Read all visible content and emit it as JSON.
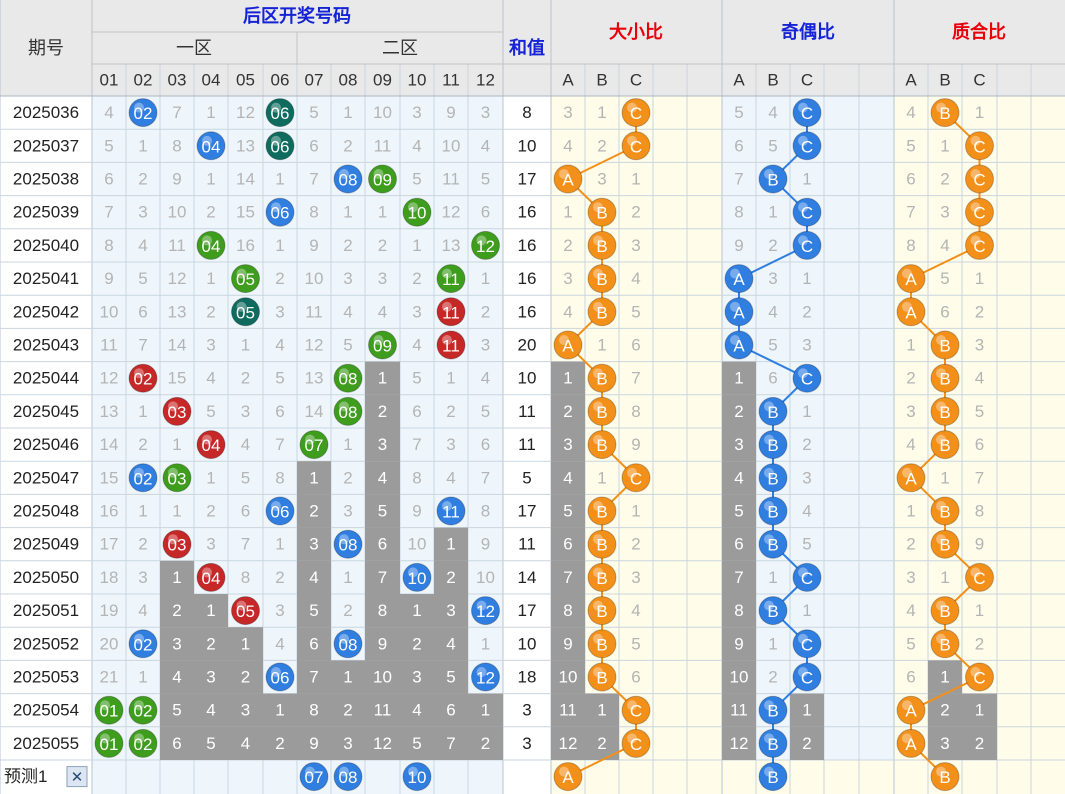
{
  "header": {
    "issue_label": "期号",
    "back_zone_title": "后区开奖号码",
    "zone1_label": "一区",
    "zone2_label": "二区",
    "sum_label": "和值",
    "size_label": "大小比",
    "parity_label": "奇偶比",
    "prime_label": "质合比",
    "predict_label": "预测1",
    "close_glyph": "✕"
  },
  "colors": {
    "header_red": "#e8000b",
    "header_blue": "#1523d6",
    "ball_blue": "#2f7ee0",
    "ball_dark_teal": "#0e6b5e",
    "ball_green": "#3f9d1e",
    "ball_red": "#c62828",
    "ball_orange": "#f39019",
    "gray_cell": "#9b9b9b"
  },
  "chart_data": {
    "type": "table",
    "number_columns": [
      "01",
      "02",
      "03",
      "04",
      "05",
      "06",
      "07",
      "08",
      "09",
      "10",
      "11",
      "12"
    ],
    "ratio_columns": [
      "A",
      "B",
      "C"
    ],
    "rows": [
      {
        "issue": "2025036",
        "nums": [
          "4",
          "02",
          "7",
          "1",
          "12",
          "06",
          "5",
          "1",
          "10",
          "3",
          "9",
          "3"
        ],
        "balls": [
          [
            2,
            "blue"
          ],
          [
            6,
            "teal"
          ]
        ],
        "sum": "8",
        "size": [
          "3",
          "1",
          "C"
        ],
        "parity": [
          "5",
          "4",
          "C"
        ],
        "prime": [
          "4",
          "B",
          "1"
        ]
      },
      {
        "issue": "2025037",
        "nums": [
          "5",
          "1",
          "8",
          "04",
          "13",
          "06",
          "6",
          "2",
          "11",
          "4",
          "10",
          "4"
        ],
        "balls": [
          [
            4,
            "blue"
          ],
          [
            6,
            "teal"
          ]
        ],
        "sum": "10",
        "size": [
          "4",
          "2",
          "C"
        ],
        "parity": [
          "6",
          "5",
          "C"
        ],
        "prime": [
          "5",
          "1",
          "C"
        ]
      },
      {
        "issue": "2025038",
        "nums": [
          "6",
          "2",
          "9",
          "1",
          "14",
          "1",
          "7",
          "08",
          "09",
          "5",
          "11",
          "5"
        ],
        "balls": [
          [
            8,
            "blue"
          ],
          [
            9,
            "green"
          ]
        ],
        "sum": "17",
        "size": [
          "A",
          "3",
          "1"
        ],
        "parity": [
          "7",
          "B",
          "1"
        ],
        "prime": [
          "6",
          "2",
          "C"
        ]
      },
      {
        "issue": "2025039",
        "nums": [
          "7",
          "3",
          "10",
          "2",
          "15",
          "06",
          "8",
          "1",
          "1",
          "10",
          "12",
          "6"
        ],
        "balls": [
          [
            6,
            "blue"
          ],
          [
            10,
            "green"
          ]
        ],
        "sum": "16",
        "size": [
          "1",
          "B",
          "2"
        ],
        "parity": [
          "8",
          "1",
          "C"
        ],
        "prime": [
          "7",
          "3",
          "C"
        ]
      },
      {
        "issue": "2025040",
        "nums": [
          "8",
          "4",
          "11",
          "04",
          "16",
          "1",
          "9",
          "2",
          "2",
          "1",
          "13",
          "12"
        ],
        "balls": [
          [
            4,
            "green"
          ],
          [
            12,
            "green"
          ]
        ],
        "sum": "16",
        "size": [
          "2",
          "B",
          "3"
        ],
        "parity": [
          "9",
          "2",
          "C"
        ],
        "prime": [
          "8",
          "4",
          "C"
        ]
      },
      {
        "issue": "2025041",
        "nums": [
          "9",
          "5",
          "12",
          "1",
          "05",
          "2",
          "10",
          "3",
          "3",
          "2",
          "11",
          "1"
        ],
        "balls": [
          [
            5,
            "green"
          ],
          [
            11,
            "green"
          ]
        ],
        "sum": "16",
        "size": [
          "3",
          "B",
          "4"
        ],
        "parity": [
          "A",
          "3",
          "1"
        ],
        "prime": [
          "A",
          "5",
          "1"
        ]
      },
      {
        "issue": "2025042",
        "nums": [
          "10",
          "6",
          "13",
          "2",
          "05",
          "3",
          "11",
          "4",
          "4",
          "3",
          "11",
          "2"
        ],
        "balls": [
          [
            5,
            "teal"
          ],
          [
            11,
            "red"
          ]
        ],
        "sum": "16",
        "size": [
          "4",
          "B",
          "5"
        ],
        "parity": [
          "A",
          "4",
          "2"
        ],
        "prime": [
          "A",
          "6",
          "2"
        ]
      },
      {
        "issue": "2025043",
        "nums": [
          "11",
          "7",
          "14",
          "3",
          "1",
          "4",
          "12",
          "5",
          "09",
          "4",
          "11",
          "3"
        ],
        "balls": [
          [
            9,
            "green"
          ],
          [
            11,
            "red"
          ]
        ],
        "sum": "20",
        "size": [
          "A",
          "1",
          "6"
        ],
        "parity": [
          "A",
          "5",
          "3"
        ],
        "prime": [
          "1",
          "B",
          "3"
        ]
      },
      {
        "issue": "2025044",
        "nums": [
          "12",
          "02",
          "15",
          "4",
          "2",
          "5",
          "13",
          "08",
          "1",
          "5",
          "1",
          "4"
        ],
        "balls": [
          [
            2,
            "red"
          ],
          [
            8,
            "green"
          ]
        ],
        "sum": "10",
        "size": [
          "1",
          "B",
          "7"
        ],
        "parity": [
          "1",
          "6",
          "C"
        ],
        "prime": [
          "2",
          "B",
          "4"
        ]
      },
      {
        "issue": "2025045",
        "nums": [
          "13",
          "1",
          "03",
          "5",
          "3",
          "6",
          "14",
          "08",
          "2",
          "6",
          "2",
          "5"
        ],
        "balls": [
          [
            3,
            "red"
          ],
          [
            8,
            "green"
          ]
        ],
        "sum": "11",
        "size": [
          "2",
          "B",
          "8"
        ],
        "parity": [
          "2",
          "B",
          "1"
        ],
        "prime": [
          "3",
          "B",
          "5"
        ]
      },
      {
        "issue": "2025046",
        "nums": [
          "14",
          "2",
          "1",
          "04",
          "4",
          "7",
          "07",
          "1",
          "3",
          "7",
          "3",
          "6"
        ],
        "balls": [
          [
            4,
            "red"
          ],
          [
            7,
            "green"
          ]
        ],
        "sum": "11",
        "size": [
          "3",
          "B",
          "9"
        ],
        "parity": [
          "3",
          "B",
          "2"
        ],
        "prime": [
          "4",
          "B",
          "6"
        ]
      },
      {
        "issue": "2025047",
        "nums": [
          "15",
          "02",
          "03",
          "1",
          "5",
          "8",
          "1",
          "2",
          "4",
          "8",
          "4",
          "7"
        ],
        "balls": [
          [
            2,
            "blue"
          ],
          [
            3,
            "green"
          ]
        ],
        "sum": "5",
        "size": [
          "4",
          "1",
          "C"
        ],
        "parity": [
          "4",
          "B",
          "3"
        ],
        "prime": [
          "A",
          "1",
          "7"
        ]
      },
      {
        "issue": "2025048",
        "nums": [
          "16",
          "1",
          "1",
          "2",
          "6",
          "06",
          "2",
          "3",
          "5",
          "9",
          "11",
          "8"
        ],
        "balls": [
          [
            6,
            "blue"
          ],
          [
            11,
            "blue"
          ]
        ],
        "sum": "17",
        "size": [
          "5",
          "B",
          "1"
        ],
        "parity": [
          "5",
          "B",
          "4"
        ],
        "prime": [
          "1",
          "B",
          "8"
        ]
      },
      {
        "issue": "2025049",
        "nums": [
          "17",
          "2",
          "03",
          "3",
          "7",
          "1",
          "3",
          "08",
          "6",
          "10",
          "1",
          "9"
        ],
        "balls": [
          [
            3,
            "red"
          ],
          [
            8,
            "blue"
          ]
        ],
        "sum": "11",
        "size": [
          "6",
          "B",
          "2"
        ],
        "parity": [
          "6",
          "B",
          "5"
        ],
        "prime": [
          "2",
          "B",
          "9"
        ]
      },
      {
        "issue": "2025050",
        "nums": [
          "18",
          "3",
          "1",
          "04",
          "8",
          "2",
          "4",
          "1",
          "7",
          "10",
          "2",
          "10"
        ],
        "balls": [
          [
            4,
            "red"
          ],
          [
            10,
            "blue"
          ]
        ],
        "sum": "14",
        "size": [
          "7",
          "B",
          "3"
        ],
        "parity": [
          "7",
          "1",
          "C"
        ],
        "prime": [
          "3",
          "1",
          "C"
        ]
      },
      {
        "issue": "2025051",
        "nums": [
          "19",
          "4",
          "2",
          "1",
          "05",
          "3",
          "5",
          "2",
          "8",
          "1",
          "3",
          "12"
        ],
        "balls": [
          [
            5,
            "red"
          ],
          [
            12,
            "blue"
          ]
        ],
        "sum": "17",
        "size": [
          "8",
          "B",
          "4"
        ],
        "parity": [
          "8",
          "B",
          "1"
        ],
        "prime": [
          "4",
          "B",
          "1"
        ]
      },
      {
        "issue": "2025052",
        "nums": [
          "20",
          "02",
          "3",
          "2",
          "1",
          "4",
          "6",
          "08",
          "9",
          "2",
          "4",
          "1"
        ],
        "balls": [
          [
            2,
            "blue"
          ],
          [
            8,
            "blue"
          ]
        ],
        "sum": "10",
        "size": [
          "9",
          "B",
          "5"
        ],
        "parity": [
          "9",
          "1",
          "C"
        ],
        "prime": [
          "5",
          "B",
          "2"
        ]
      },
      {
        "issue": "2025053",
        "nums": [
          "21",
          "1",
          "4",
          "3",
          "2",
          "06",
          "7",
          "1",
          "10",
          "3",
          "5",
          "12"
        ],
        "balls": [
          [
            6,
            "blue"
          ],
          [
            12,
            "blue"
          ]
        ],
        "sum": "18",
        "size": [
          "10",
          "B",
          "6"
        ],
        "parity": [
          "10",
          "2",
          "C"
        ],
        "prime": [
          "6",
          "1",
          "C"
        ]
      },
      {
        "issue": "2025054",
        "nums": [
          "01",
          "02",
          "5",
          "4",
          "3",
          "1",
          "8",
          "2",
          "11",
          "4",
          "6",
          "1"
        ],
        "balls": [
          [
            1,
            "green"
          ],
          [
            2,
            "green"
          ]
        ],
        "sum": "3",
        "size": [
          "11",
          "1",
          "C"
        ],
        "parity": [
          "11",
          "B",
          "1"
        ],
        "prime": [
          "A",
          "2",
          "1"
        ]
      },
      {
        "issue": "2025055",
        "nums": [
          "01",
          "02",
          "6",
          "5",
          "4",
          "2",
          "9",
          "3",
          "12",
          "5",
          "7",
          "2"
        ],
        "balls": [
          [
            1,
            "green"
          ],
          [
            2,
            "green"
          ]
        ],
        "sum": "3",
        "size": [
          "12",
          "2",
          "C"
        ],
        "parity": [
          "12",
          "B",
          "2"
        ],
        "prime": [
          "A",
          "3",
          "2"
        ]
      }
    ],
    "gray_cells": [
      [
        8,
        9
      ],
      [
        9,
        9
      ],
      [
        10,
        9
      ],
      [
        11,
        7
      ],
      [
        11,
        9
      ],
      [
        12,
        7
      ],
      [
        12,
        9
      ],
      [
        13,
        7
      ],
      [
        13,
        9
      ],
      [
        13,
        11
      ],
      [
        14,
        3
      ],
      [
        14,
        7
      ],
      [
        14,
        9
      ],
      [
        14,
        11
      ],
      [
        15,
        3
      ],
      [
        15,
        4
      ],
      [
        15,
        7
      ],
      [
        15,
        9
      ],
      [
        15,
        10
      ],
      [
        15,
        11
      ],
      [
        16,
        3
      ],
      [
        16,
        4
      ],
      [
        16,
        5
      ],
      [
        16,
        7
      ],
      [
        16,
        9
      ],
      [
        16,
        10
      ],
      [
        16,
        11
      ],
      [
        17,
        3
      ],
      [
        17,
        4
      ],
      [
        17,
        5
      ],
      [
        17,
        7
      ],
      [
        17,
        8
      ],
      [
        17,
        9
      ],
      [
        17,
        10
      ],
      [
        17,
        11
      ],
      [
        18,
        3
      ],
      [
        18,
        4
      ],
      [
        18,
        5
      ],
      [
        18,
        6
      ],
      [
        18,
        7
      ],
      [
        18,
        8
      ],
      [
        18,
        9
      ],
      [
        18,
        10
      ],
      [
        18,
        11
      ],
      [
        18,
        12
      ],
      [
        19,
        3
      ],
      [
        19,
        4
      ],
      [
        19,
        5
      ],
      [
        19,
        6
      ],
      [
        19,
        7
      ],
      [
        19,
        8
      ],
      [
        19,
        9
      ],
      [
        19,
        10
      ],
      [
        19,
        11
      ],
      [
        19,
        12
      ]
    ],
    "gray_ratio_cells": {
      "size": [
        [
          8,
          0
        ],
        [
          9,
          0
        ],
        [
          10,
          0
        ],
        [
          11,
          0
        ],
        [
          12,
          0
        ],
        [
          13,
          0
        ],
        [
          14,
          0
        ],
        [
          15,
          0
        ],
        [
          16,
          0
        ],
        [
          17,
          0
        ],
        [
          18,
          0
        ],
        [
          18,
          1
        ],
        [
          19,
          0
        ],
        [
          19,
          1
        ]
      ],
      "parity": [
        [
          8,
          0
        ],
        [
          9,
          0
        ],
        [
          10,
          0
        ],
        [
          11,
          0
        ],
        [
          12,
          0
        ],
        [
          13,
          0
        ],
        [
          14,
          0
        ],
        [
          15,
          0
        ],
        [
          16,
          0
        ],
        [
          17,
          0
        ],
        [
          18,
          0
        ],
        [
          18,
          2
        ],
        [
          19,
          0
        ],
        [
          19,
          2
        ]
      ],
      "prime": [
        [
          17,
          1
        ],
        [
          18,
          1
        ],
        [
          18,
          2
        ],
        [
          19,
          1
        ],
        [
          19,
          2
        ]
      ]
    },
    "predict": {
      "balls": [
        [
          7,
          "blue"
        ],
        [
          8,
          "blue"
        ],
        [
          10,
          "blue"
        ]
      ],
      "size_pick": "A",
      "parity_pick": "B",
      "prime_pick": "B"
    }
  }
}
